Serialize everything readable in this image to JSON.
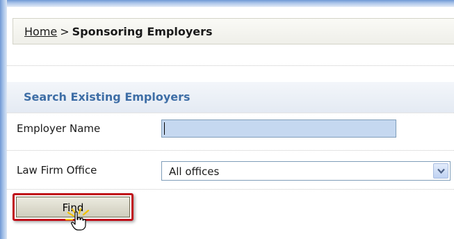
{
  "breadcrumb": {
    "home": "Home",
    "separator": ">",
    "current": "Sponsoring Employers"
  },
  "section": {
    "title": "Search Existing Employers"
  },
  "form": {
    "employer_name_label": "Employer Name",
    "employer_name_value": "",
    "law_firm_office_label": "Law Firm Office",
    "law_firm_office_selected": "All offices"
  },
  "actions": {
    "find_label": "Find"
  },
  "icons": {
    "dropdown": "chevron-down-icon",
    "cursor": "hand-pointer-icon"
  },
  "colors": {
    "accent_title": "#3e6ea6",
    "highlight": "#c0101a",
    "input_bg": "#c5d8f0"
  }
}
